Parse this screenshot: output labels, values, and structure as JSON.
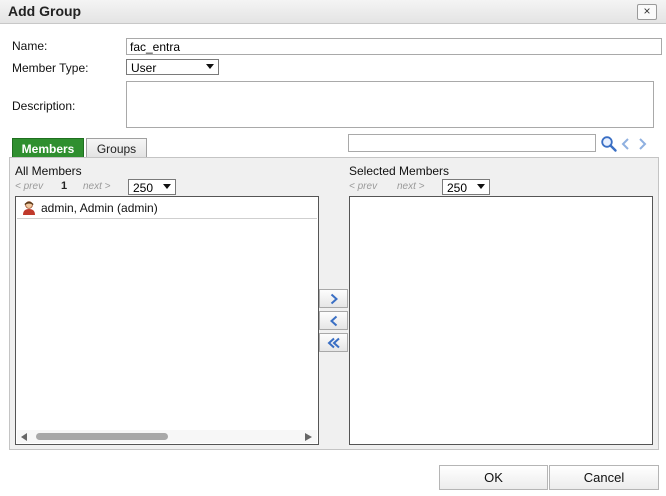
{
  "dialog": {
    "title": "Add Group",
    "close_label": "×"
  },
  "form": {
    "name_label": "Name:",
    "name_value": "fac_entra",
    "member_type_label": "Member Type:",
    "member_type_value": "User",
    "description_label": "Description:",
    "description_value": ""
  },
  "tabs": [
    {
      "label": "Members",
      "active": true
    },
    {
      "label": "Groups",
      "active": false
    }
  ],
  "search": {
    "value": "",
    "icons": [
      "search-icon",
      "chevron-left-icon",
      "chevron-right-icon"
    ]
  },
  "all_members": {
    "title": "All Members",
    "prev_label": "< prev",
    "page": "1",
    "next_label": "next >",
    "page_size": "250",
    "items": [
      {
        "label": "admin, Admin (admin)",
        "icon": "user-icon"
      }
    ]
  },
  "selected_members": {
    "title": "Selected Members",
    "prev_label": "< prev",
    "next_label": "next >",
    "page_size": "250",
    "items": []
  },
  "move_buttons": [
    "chevron-right-icon",
    "chevron-left-icon",
    "double-chevron-left-icon"
  ],
  "footer": {
    "ok_label": "OK",
    "cancel_label": "Cancel"
  },
  "colors": {
    "active_tab": "#2f8f2f",
    "icon_blue": "#3a6fc4"
  }
}
